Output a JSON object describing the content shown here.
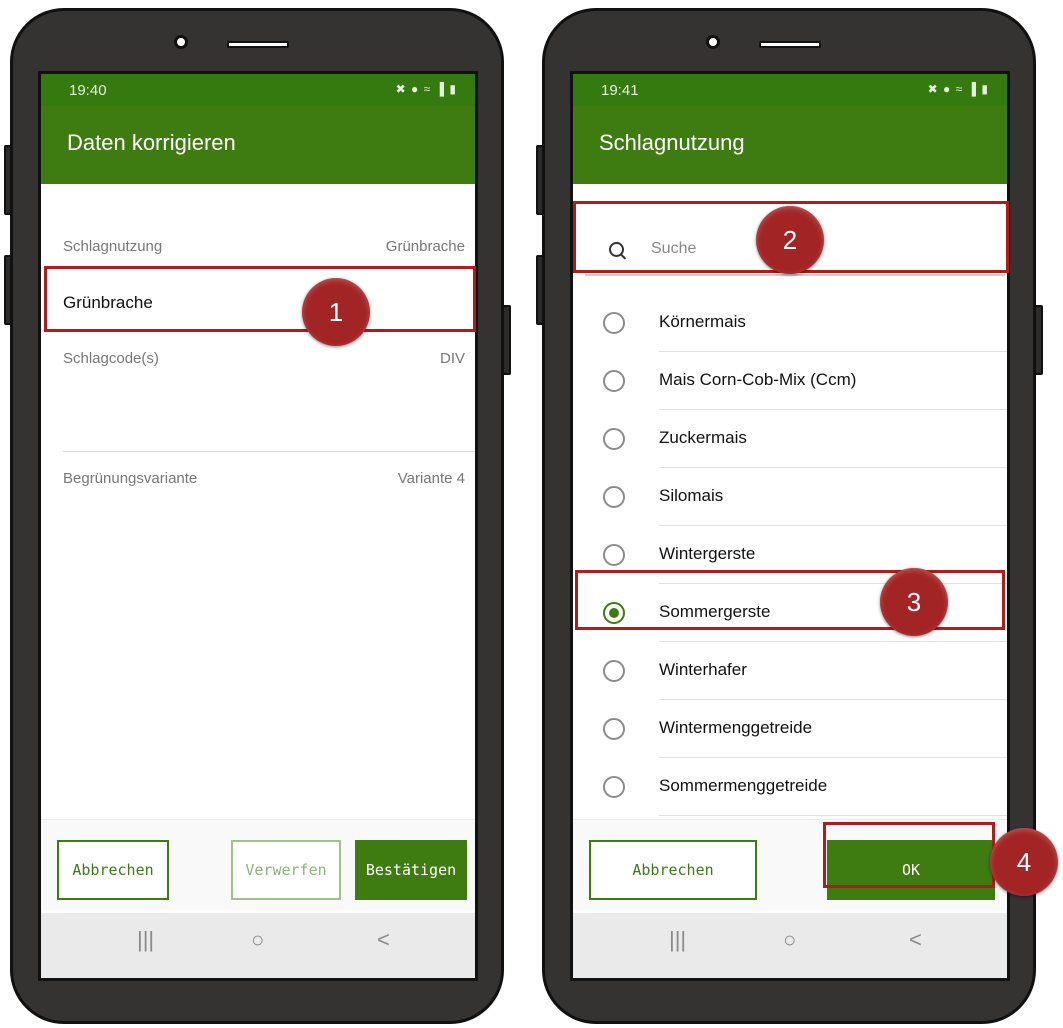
{
  "left_screen": {
    "status_time": "19:40",
    "status_icons": "✖ ● ≈ ▐ ▮",
    "title": "Daten korrigieren",
    "rows": {
      "schlagnutzung_label": "Schlagnutzung",
      "schlagnutzung_value": "Grünbrache",
      "selected_value": "Grünbrache",
      "schlagcode_label": "Schlagcode(s)",
      "schlagcode_value": "DIV",
      "begruenung_label": "Begrünungsvariante",
      "begruenung_value": "Variante 4"
    },
    "buttons": {
      "cancel": "Abbrechen",
      "discard": "Verwerfen",
      "confirm": "Bestätigen"
    },
    "badge": "1"
  },
  "right_screen": {
    "status_time": "19:41",
    "status_icons": "✖ ● ≈ ▐ ▮",
    "title": "Schlagnutzung",
    "search_placeholder": "Suche",
    "options": [
      {
        "label": "Körnermais",
        "checked": false
      },
      {
        "label": "Mais Corn-Cob-Mix (Ccm)",
        "checked": false
      },
      {
        "label": "Zuckermais",
        "checked": false
      },
      {
        "label": "Silomais",
        "checked": false
      },
      {
        "label": "Wintergerste",
        "checked": false
      },
      {
        "label": "Sommergerste",
        "checked": true
      },
      {
        "label": "Winterhafer",
        "checked": false
      },
      {
        "label": "Wintermenggetreide",
        "checked": false
      },
      {
        "label": "Sommermenggetreide",
        "checked": false
      }
    ],
    "buttons": {
      "cancel": "Abbrechen",
      "ok": "OK"
    },
    "badges": [
      "2",
      "3",
      "4"
    ]
  },
  "nav_icons": {
    "recent": "|||",
    "home": "○",
    "back": "<"
  },
  "colors": {
    "brand_green": "#3e7b10",
    "highlight_red": "#b01c1c",
    "badge_red": "#a32424",
    "phone_body": "#353232"
  }
}
